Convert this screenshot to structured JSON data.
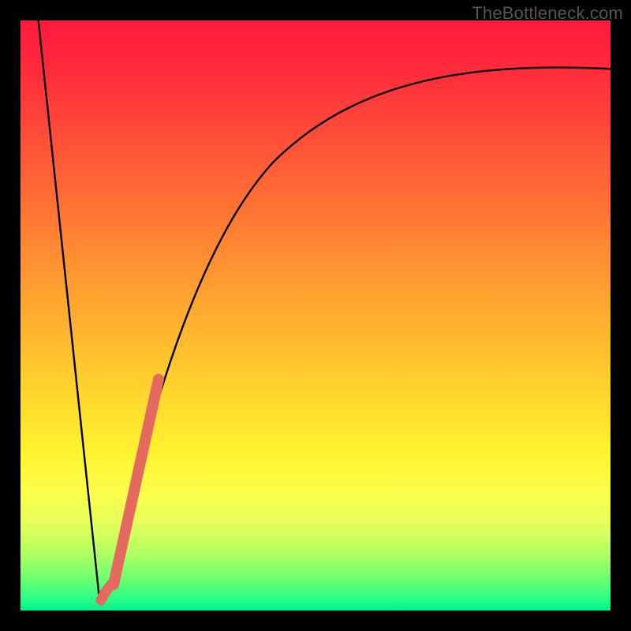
{
  "watermark": "TheBottleneck.com",
  "colors": {
    "curve": "#000000",
    "marker": "#e46a60",
    "frame": "#000000"
  },
  "chart_data": {
    "type": "line",
    "title": "",
    "xlabel": "",
    "ylabel": "",
    "xlim": [
      0,
      100
    ],
    "ylim": [
      0,
      100
    ],
    "grid": false,
    "legend": false,
    "series": [
      {
        "name": "bottleneck-curve-left",
        "x": [
          3,
          13
        ],
        "y": [
          100,
          2
        ]
      },
      {
        "name": "bottleneck-curve-right",
        "x": [
          13,
          15,
          17,
          19,
          21,
          24,
          28,
          33,
          40,
          50,
          62,
          78,
          100
        ],
        "y": [
          2,
          10,
          18,
          26,
          34,
          44,
          55,
          65,
          74,
          81,
          86,
          89,
          91
        ]
      },
      {
        "name": "marker-segment",
        "x": [
          14.5,
          22.5
        ],
        "y": [
          4,
          40
        ]
      },
      {
        "name": "marker-hook",
        "x": [
          13.2,
          14.5
        ],
        "y": [
          2,
          6
        ]
      }
    ],
    "annotations": []
  }
}
